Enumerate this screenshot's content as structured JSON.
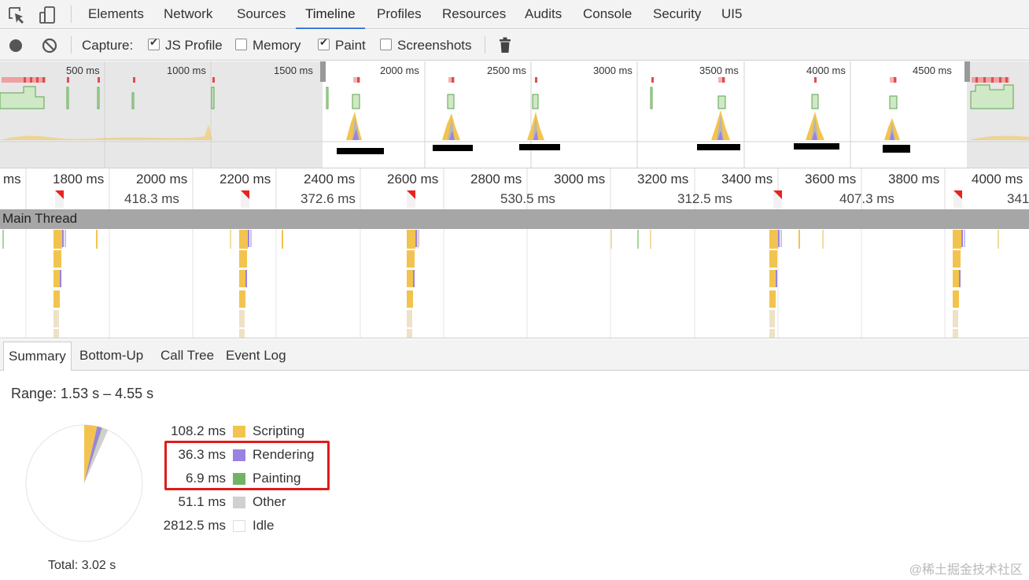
{
  "tabs": [
    "Elements",
    "Network",
    "Sources",
    "Timeline",
    "Profiles",
    "Resources",
    "Audits",
    "Console",
    "Security",
    "UI5"
  ],
  "active_tab": "Timeline",
  "capture": {
    "label": "Capture:",
    "options": [
      {
        "label": "JS Profile",
        "checked": true
      },
      {
        "label": "Memory",
        "checked": false
      },
      {
        "label": "Paint",
        "checked": true
      },
      {
        "label": "Screenshots",
        "checked": false
      }
    ]
  },
  "overview_ticks": [
    "500 ms",
    "1000 ms",
    "1500 ms",
    "2000 ms",
    "2500 ms",
    "3000 ms",
    "3500 ms",
    "4000 ms",
    "4500 ms"
  ],
  "ruler_ticks": [
    "ms",
    "1800 ms",
    "2000 ms",
    "2200 ms",
    "2400 ms",
    "2600 ms",
    "2800 ms",
    "3000 ms",
    "3200 ms",
    "3400 ms",
    "3600 ms",
    "3800 ms",
    "4000 ms"
  ],
  "frame_durations": [
    "418.3 ms",
    "372.6 ms",
    "530.5 ms",
    "312.5 ms",
    "407.3 ms",
    "341"
  ],
  "main_thread_label": "Main Thread",
  "bottom_tabs": [
    "Summary",
    "Bottom-Up",
    "Call Tree",
    "Event Log"
  ],
  "active_bottom_tab": "Summary",
  "summary": {
    "range": "Range: 1.53 s – 4.55 s",
    "legend": [
      {
        "value": "108.2 ms",
        "label": "Scripting",
        "color": "#f2c44f"
      },
      {
        "value": "36.3 ms",
        "label": "Rendering",
        "color": "#9b82e0"
      },
      {
        "value": "6.9 ms",
        "label": "Painting",
        "color": "#71b363"
      },
      {
        "value": "51.1 ms",
        "label": "Other",
        "color": "#d0d0d0"
      },
      {
        "value": "2812.5 ms",
        "label": "Idle",
        "color": "#ffffff"
      }
    ],
    "total": "Total: 3.02 s"
  },
  "watermark": "@稀土掘金技术社区"
}
